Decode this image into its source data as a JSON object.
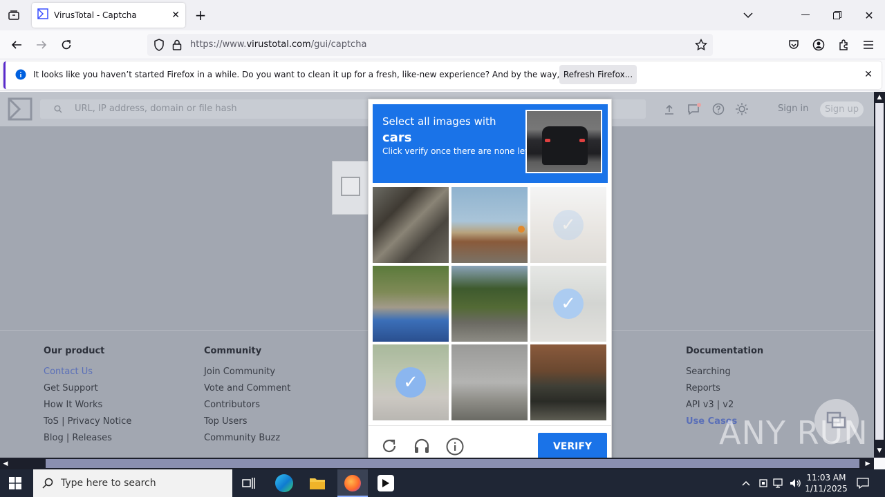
{
  "browser": {
    "tab_title": "VirusTotal - Captcha",
    "url_prefix": "https://www.",
    "url_domain": "virustotal.com",
    "url_path": "/gui/captcha"
  },
  "notification": {
    "message": "It looks like you haven’t started Firefox in a while. Do you want to clean it up for a fresh, like-new experience? And by the way, welcome back!",
    "button": "Refresh Firefox..."
  },
  "vt": {
    "search_placeholder": "URL, IP address, domain or file hash",
    "signin": "Sign in",
    "signup": "Sign up"
  },
  "footer": {
    "columns": [
      {
        "heading": "Our product",
        "links": [
          "Contact Us",
          "Get Support",
          "How It Works",
          "ToS | Privacy Notice",
          "Blog | Releases"
        ]
      },
      {
        "heading": "Community",
        "links": [
          "Join Community",
          "Vote and Comment",
          "Contributors",
          "Top Users",
          "Community Buzz"
        ]
      },
      {
        "heading": "Documentation",
        "links": [
          "Searching",
          "Reports",
          "API v3 | v2",
          "Use Cases"
        ]
      }
    ]
  },
  "captcha": {
    "line1": "Select all images with",
    "target": "cars",
    "line3": "Click verify once there are none left",
    "verify": "VERIFY",
    "selected_tiles": [
      2,
      5,
      6
    ]
  },
  "taskbar": {
    "search_placeholder": "Type here to search",
    "time": "11:03 AM",
    "date": "1/11/2025"
  },
  "watermark": "ANY RUN",
  "colors": {
    "accent": "#1a73e8",
    "firefox_purple": "#592acb"
  }
}
